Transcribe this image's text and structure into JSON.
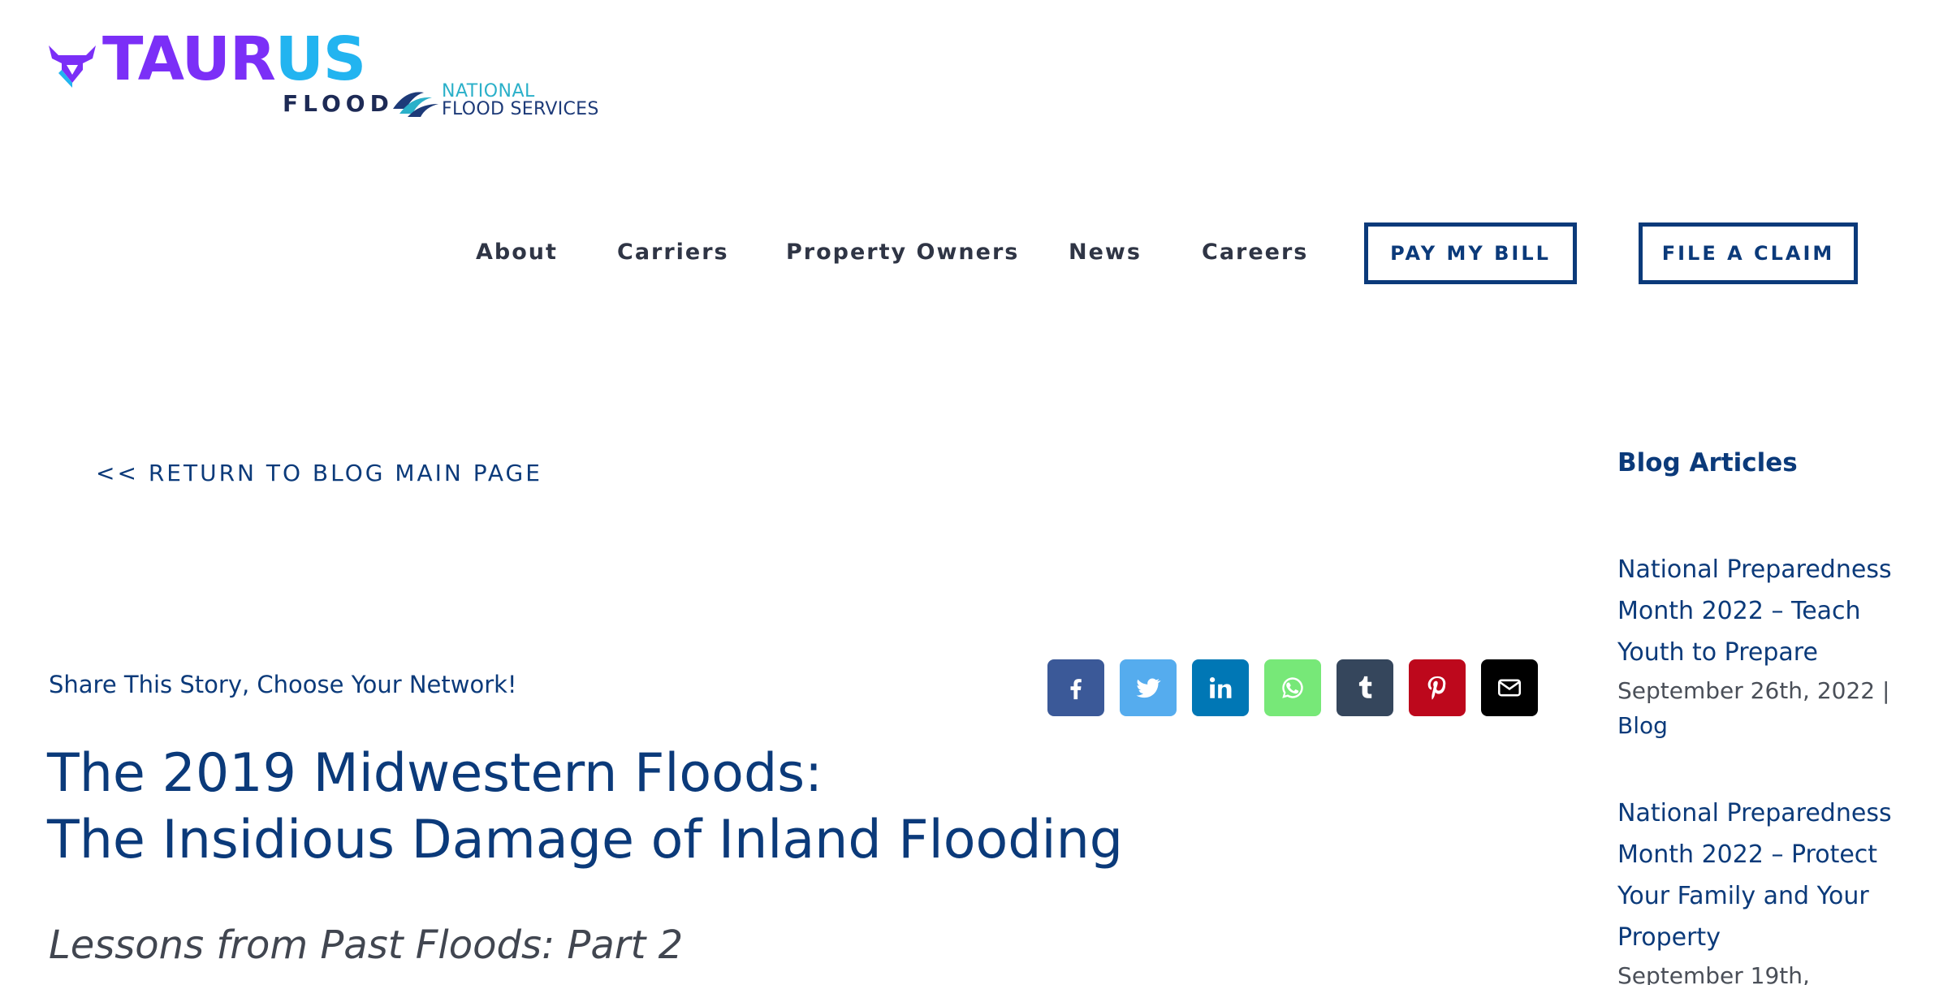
{
  "logo": {
    "brand_part1": "TAUR",
    "brand_part2": "US",
    "sub": "FLOOD",
    "partner_line1": "NATIONAL",
    "partner_line2": "FLOOD SERVICES",
    "colors": {
      "purple": "#7b2ff7",
      "cyan": "#22b4f0",
      "navy": "#1d2a55",
      "teal": "#2bb0c9"
    }
  },
  "nav": {
    "items": [
      "About",
      "Carriers",
      "Property Owners",
      "News",
      "Careers"
    ],
    "pay_bill": "PAY MY BILL",
    "file_claim": "FILE A CLAIM"
  },
  "return_link": "<< RETURN TO BLOG MAIN PAGE",
  "share": {
    "text": "Share This Story, Choose Your Network!",
    "networks": [
      {
        "icon": "facebook-icon",
        "color": "#3b5998"
      },
      {
        "icon": "twitter-icon",
        "color": "#55acee"
      },
      {
        "icon": "linkedin-icon",
        "color": "#0077b5"
      },
      {
        "icon": "whatsapp-icon",
        "color": "#77e878"
      },
      {
        "icon": "tumblr-icon",
        "color": "#35465c"
      },
      {
        "icon": "pinterest-icon",
        "color": "#bd081c"
      },
      {
        "icon": "email-icon",
        "color": "#000000"
      }
    ]
  },
  "post": {
    "title_line1": "The 2019 Midwestern Floods:",
    "title_line2": "The Insidious Damage of Inland Flooding",
    "subtitle": "Lessons from Past Floods: Part 2"
  },
  "sidebar": {
    "heading": "Blog Articles",
    "articles": [
      {
        "title": "National Preparedness Month 2022 – Teach Youth to Prepare",
        "date": "September 26th, 2022",
        "separator": " | ",
        "category": "Blog"
      },
      {
        "title": "National Preparedness Month 2022 – Protect Your Family and Your Property",
        "date": "September 19th,",
        "separator": "",
        "category": ""
      }
    ]
  },
  "theme": {
    "primary": "#0b3a7a",
    "nav_text": "#2f3545"
  }
}
